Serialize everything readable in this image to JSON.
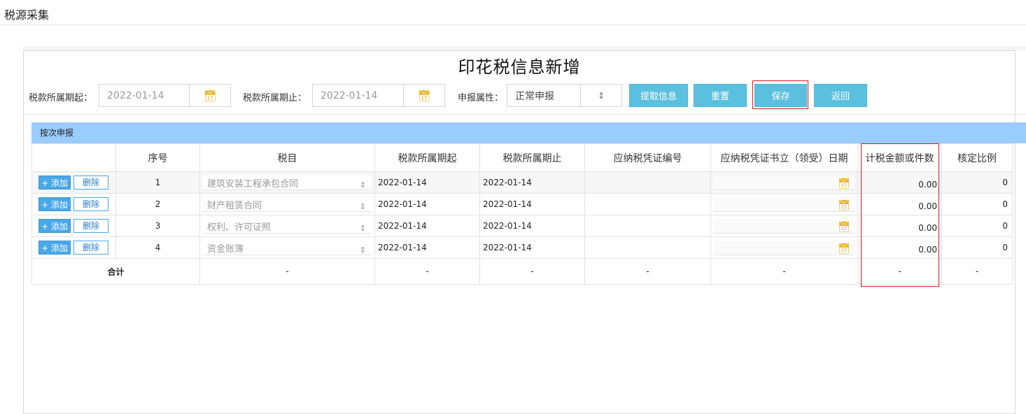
{
  "page": {
    "title": "税源采集"
  },
  "form": {
    "title": "印花税信息新增",
    "period_start": {
      "label": "税款所属期起：",
      "value": "2022-01-14",
      "icon": "calendar-icon"
    },
    "period_end": {
      "label": "税款所属期止：",
      "value": "2022-01-14",
      "icon": "calendar-icon"
    },
    "declare_attr": {
      "label": "申报属性：",
      "value": "正常申报",
      "icon": "select-arrow-icon"
    },
    "buttons": {
      "fetch": "提取信息",
      "reset": "重置",
      "save": "保存",
      "back": "返回"
    }
  },
  "section": {
    "title": "按次申报"
  },
  "table": {
    "headers": [
      "",
      "序号",
      "税目",
      "税款所属期起",
      "税款所属期止",
      "应纳税凭证编号",
      "应纳税凭证书立（领受）日期",
      "计税金额或件数",
      "核定比例"
    ],
    "add_label": "+ 添加",
    "delete_label": "删除",
    "rows": [
      {
        "no": "1",
        "item": "建筑安装工程承包合同",
        "start": "2022-01-14",
        "end": "2022-01-14",
        "voucher": "",
        "amount": "0.00",
        "ratio": "0"
      },
      {
        "no": "2",
        "item": "财产租赁合同",
        "start": "2022-01-14",
        "end": "2022-01-14",
        "voucher": "",
        "amount": "0.00",
        "ratio": "0"
      },
      {
        "no": "3",
        "item": "权利、许可证照",
        "start": "2022-01-14",
        "end": "2022-01-14",
        "voucher": "",
        "amount": "0.00",
        "ratio": "0"
      },
      {
        "no": "4",
        "item": "资金账簿",
        "start": "2022-01-14",
        "end": "2022-01-14",
        "voucher": "",
        "amount": "0.00",
        "ratio": "0"
      }
    ],
    "total": {
      "label": "合计",
      "dash": "-"
    }
  },
  "colors": {
    "accent": "#5bc0de",
    "section_bar": "#99ccff",
    "highlight": "#d9151c",
    "calendar": "#e6b220"
  }
}
